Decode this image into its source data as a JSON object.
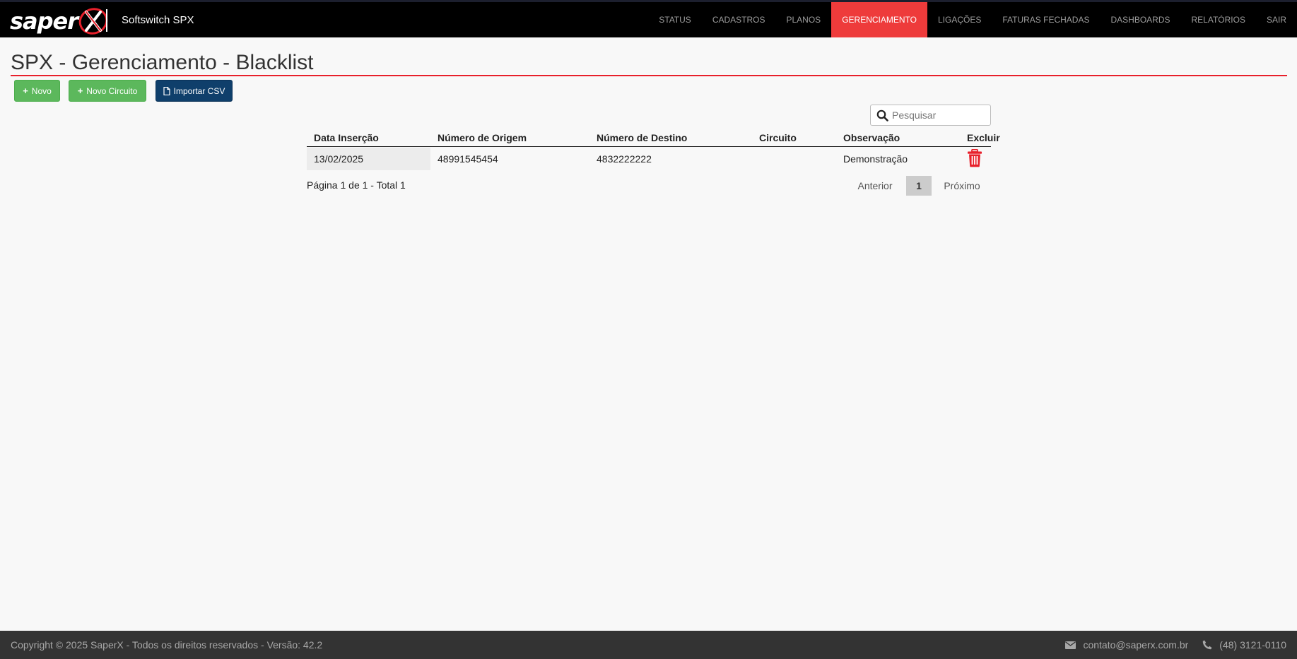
{
  "brand": {
    "logo_text": "saper",
    "app_name": "Softswitch SPX"
  },
  "nav": {
    "items": [
      {
        "label": "STATUS"
      },
      {
        "label": "CADASTROS"
      },
      {
        "label": "PLANOS"
      },
      {
        "label": "GERENCIAMENTO",
        "active": true
      },
      {
        "label": "LIGAÇÕES"
      },
      {
        "label": "FATURAS FECHADAS"
      },
      {
        "label": "DASHBOARDS"
      },
      {
        "label": "RELATÓRIOS"
      },
      {
        "label": "SAIR"
      }
    ]
  },
  "page": {
    "title": "SPX - Gerenciamento - Blacklist"
  },
  "toolbar": {
    "novo_label": "Novo",
    "novo_circuito_label": "Novo Circuito",
    "importar_csv_label": "Importar CSV"
  },
  "search": {
    "placeholder": "Pesquisar"
  },
  "table": {
    "headers": {
      "data_insercao": "Data Inserção",
      "numero_origem": "Número de Origem",
      "numero_destino": "Número de Destino",
      "circuito": "Circuito",
      "observacao": "Observação",
      "excluir": "Excluir"
    },
    "rows": [
      {
        "data_insercao": "13/02/2025",
        "numero_origem": "48991545454",
        "numero_destino": "4832222222",
        "circuito": "",
        "observacao": "Demonstração"
      }
    ]
  },
  "pagination": {
    "info": "Página 1 de 1 - Total 1",
    "prev_label": "Anterior",
    "current_page": "1",
    "next_label": "Próximo"
  },
  "footer": {
    "copyright": "Copyright © 2025 SaperX - Todos os direitos reservados - Versão: 42.2",
    "email": "contato@saperx.com.br",
    "phone": "(48) 3121-0110"
  },
  "colors": {
    "accent": "#ee3b3b",
    "success": "#5cb85c",
    "primary_dark": "#0f3f6b",
    "trash": "#e8202b"
  }
}
